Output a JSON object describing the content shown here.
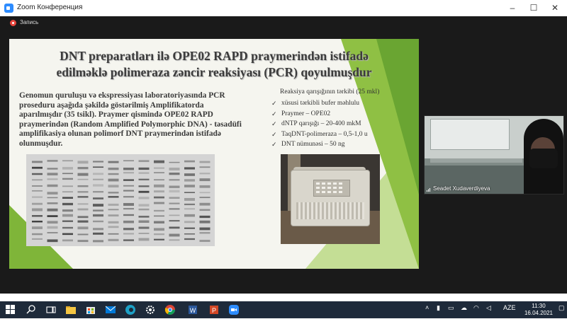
{
  "window": {
    "title": "Zoom Конференция",
    "minimize": "–",
    "maximize": "☐",
    "close": "✕",
    "accent": "#2d8cff"
  },
  "recording": {
    "label": "Запись",
    "color": "#e8453c"
  },
  "slide": {
    "title_line1": "DNT preparatları ilə OPE02 RAPD praymerindən istifadə",
    "title_line2": "edilməklə polimeraza zəncir reaksiyası (PCR) qoyulmuşdur",
    "body": "Genomun quruluşu və ekspressiyası laboratoriyasında PCR proseduru aşağıda şəkildə göstərilmiş Amplifikatorda aparılmışdır (35 tsikl). Praymer qismində OPE02 RAPD praymerindən (Random Amplified Polymorphic DNA) - təsadüfi amplifikasiya olunan polimorf  DNT praymerindən istifadə olunmuşdur.",
    "reaction_title": "Reaksiya qarışığının tərkibi  (25 mkl)",
    "reaction_items": [
      "xüsusi tərkibli  bufer məhlulu",
      "Praymer – OPE02",
      "dNTP qarışığı – 20-400 mkM",
      "TaqDNT-polimeraza – 0,5-1,0 u",
      "DNT nümunəsi – 50 ng"
    ],
    "accent_green": "#8fc044"
  },
  "video": {
    "participant_name": "Seadet Xudaverdiyeva"
  },
  "taskbar": {
    "apps": [
      "search-icon",
      "task-view-icon",
      "file-explorer-icon",
      "store-icon",
      "mail-icon",
      "edge-icon",
      "settings-icon",
      "chrome-icon",
      "word-icon",
      "powerpoint-icon",
      "zoom-icon"
    ],
    "language": "AZE",
    "time": "11:30",
    "date": "16.04.2021"
  }
}
